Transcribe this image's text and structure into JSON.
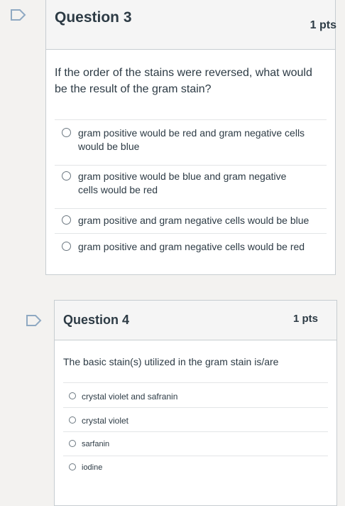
{
  "questions": [
    {
      "title": "Question 3",
      "points": "1 pts",
      "text": "If the order of the stains were reversed, what would be the result of the gram stain?",
      "answers": [
        "gram positive would be red and gram negative cells would be blue",
        "gram positive would be blue and gram negative cells would be red",
        "gram positive and gram negative cells would be blue",
        "gram positive and gram negative cells would be red"
      ]
    },
    {
      "title": "Question 4",
      "points": "1 pts",
      "text": "The basic stain(s) utilized in the gram stain is/are",
      "answers": [
        "crystal violet and safranin",
        "crystal violet",
        "sarfanin",
        "iodine"
      ]
    }
  ],
  "icons": {
    "flag": "flag-icon",
    "radio": "radio-button-icon"
  },
  "colors": {
    "flag_stroke": "#8fa9c2",
    "border": "#c7cdd1",
    "header_bg": "#f5f5f5"
  }
}
